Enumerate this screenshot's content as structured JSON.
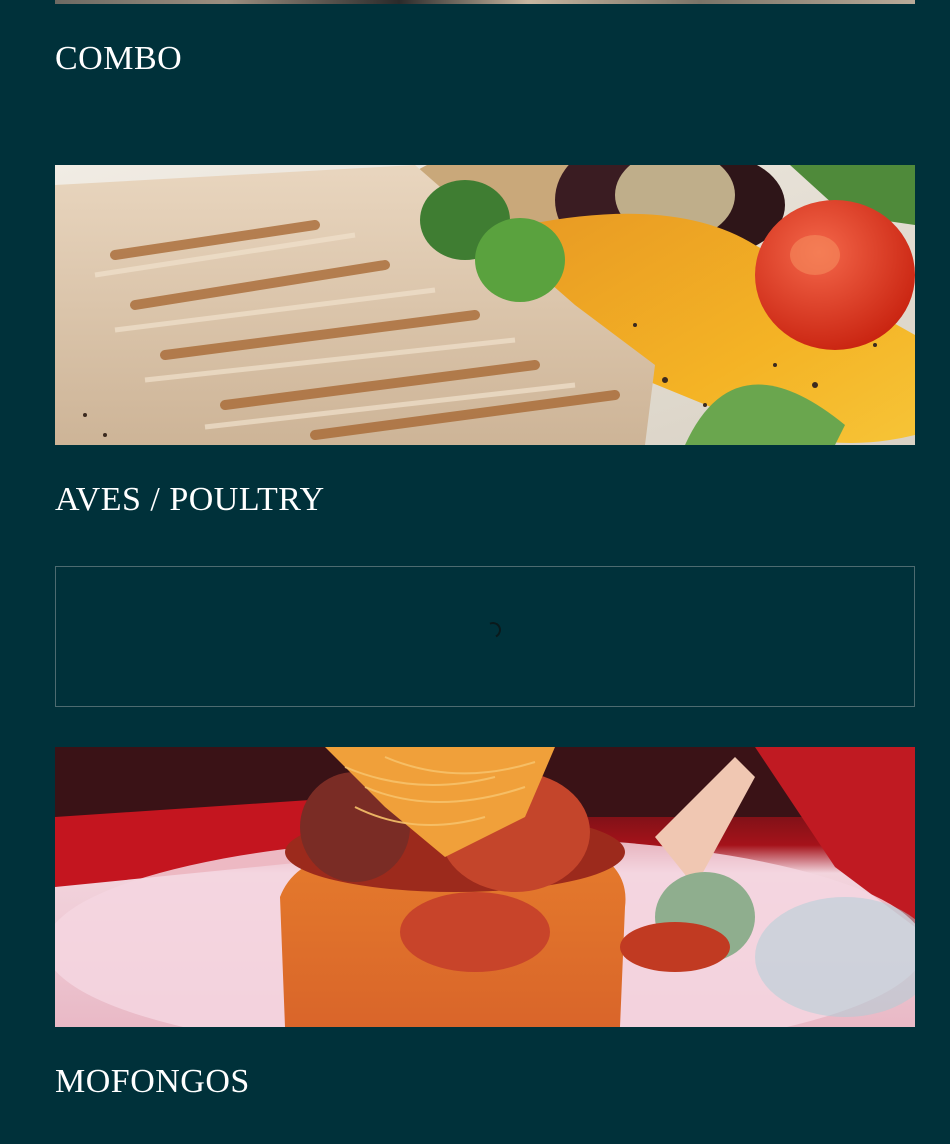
{
  "sections": [
    {
      "title": "COMBO"
    },
    {
      "title": "AVES / POULTRY",
      "image": "grilled-chicken-photo"
    },
    {
      "title": "MOFONGOS",
      "image": "mofongo-photo"
    }
  ],
  "loader": {
    "icon": "spinner-icon"
  },
  "colors": {
    "background": "#00313a",
    "text": "#ffffff",
    "loader_border": "#4d6b70"
  }
}
